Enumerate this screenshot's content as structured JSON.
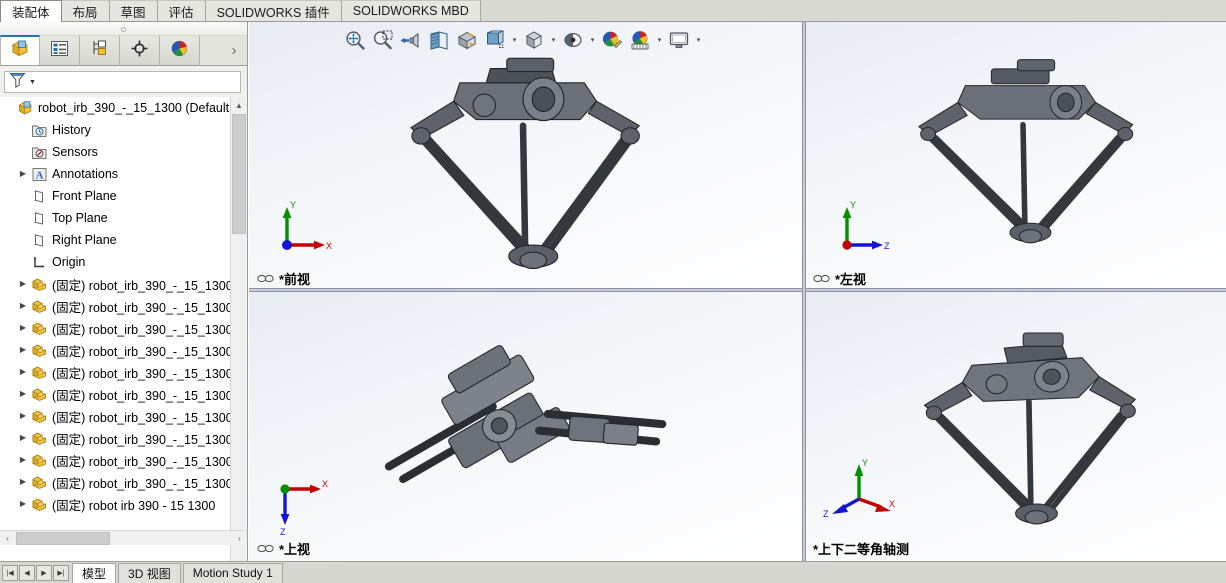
{
  "app": {
    "title": "SOLIDWORKS Assembly"
  },
  "command_manager": {
    "tabs": [
      {
        "label": "装配体",
        "active": true
      },
      {
        "label": "布局",
        "active": false
      },
      {
        "label": "草图",
        "active": false
      },
      {
        "label": "评估",
        "active": false
      },
      {
        "label": "SOLIDWORKS 插件",
        "active": false
      },
      {
        "label": "SOLIDWORKS MBD",
        "active": false
      }
    ]
  },
  "feature_manager": {
    "tabs": [
      {
        "name": "feature-tree-tab",
        "icon": "assembly-tree-icon",
        "active": true
      },
      {
        "name": "property-manager-tab",
        "icon": "property-list-icon",
        "active": false
      },
      {
        "name": "configuration-manager-tab",
        "icon": "configuration-icon",
        "active": false
      },
      {
        "name": "dimxpert-manager-tab",
        "icon": "dimxpert-target-icon",
        "active": false
      },
      {
        "name": "display-manager-tab",
        "icon": "display-sphere-icon",
        "active": false
      }
    ],
    "expand_chevron": "›",
    "filter": {
      "icon": "filter-funnel-icon",
      "value": "",
      "placeholder": ""
    },
    "tree": [
      {
        "label": "robot_irb_390_-_15_1300  (Default",
        "icon": "assembly-icon",
        "depth": 0,
        "expandable": false,
        "chevron": ""
      },
      {
        "label": "History",
        "icon": "history-folder-icon",
        "depth": 1,
        "expandable": false,
        "chevron": ""
      },
      {
        "label": "Sensors",
        "icon": "sensors-folder-icon",
        "depth": 1,
        "expandable": false,
        "chevron": ""
      },
      {
        "label": "Annotations",
        "icon": "annotations-icon",
        "depth": 1,
        "expandable": true,
        "chevron": "▶"
      },
      {
        "label": "Front Plane",
        "icon": "plane-icon",
        "depth": 1,
        "expandable": false,
        "chevron": ""
      },
      {
        "label": "Top Plane",
        "icon": "plane-icon",
        "depth": 1,
        "expandable": false,
        "chevron": ""
      },
      {
        "label": "Right Plane",
        "icon": "plane-icon",
        "depth": 1,
        "expandable": false,
        "chevron": ""
      },
      {
        "label": "Origin",
        "icon": "origin-icon",
        "depth": 1,
        "expandable": false,
        "chevron": ""
      },
      {
        "label": "(固定) robot_irb_390_-_15_1300",
        "icon": "part-icon",
        "depth": 1,
        "expandable": true,
        "chevron": "▶"
      },
      {
        "label": "(固定) robot_irb_390_-_15_1300",
        "icon": "part-icon",
        "depth": 1,
        "expandable": true,
        "chevron": "▶"
      },
      {
        "label": "(固定) robot_irb_390_-_15_1300",
        "icon": "part-icon",
        "depth": 1,
        "expandable": true,
        "chevron": "▶"
      },
      {
        "label": "(固定) robot_irb_390_-_15_1300",
        "icon": "part-icon",
        "depth": 1,
        "expandable": true,
        "chevron": "▶"
      },
      {
        "label": "(固定) robot_irb_390_-_15_1300",
        "icon": "part-icon",
        "depth": 1,
        "expandable": true,
        "chevron": "▶"
      },
      {
        "label": "(固定) robot_irb_390_-_15_1300",
        "icon": "part-icon",
        "depth": 1,
        "expandable": true,
        "chevron": "▶"
      },
      {
        "label": "(固定) robot_irb_390_-_15_1300",
        "icon": "part-icon",
        "depth": 1,
        "expandable": true,
        "chevron": "▶"
      },
      {
        "label": "(固定) robot_irb_390_-_15_1300",
        "icon": "part-icon",
        "depth": 1,
        "expandable": true,
        "chevron": "▶"
      },
      {
        "label": "(固定) robot_irb_390_-_15_1300",
        "icon": "part-icon",
        "depth": 1,
        "expandable": true,
        "chevron": "▶"
      },
      {
        "label": "(固定) robot_irb_390_-_15_1300",
        "icon": "part-icon",
        "depth": 1,
        "expandable": true,
        "chevron": "▶"
      },
      {
        "label": "(固定) robot irb 390 - 15 1300",
        "icon": "part-icon",
        "depth": 1,
        "expandable": true,
        "chevron": "▶"
      }
    ],
    "scrollbar": {
      "up_arrow": "▲",
      "down_arrow": "▼",
      "left_arrow": "‹",
      "right_arrow": "›"
    }
  },
  "view_toolbar": {
    "buttons": [
      {
        "name": "zoom-to-fit-button",
        "icon": "zoom-to-fit-icon",
        "caret": false
      },
      {
        "name": "zoom-to-area-button",
        "icon": "zoom-to-area-icon",
        "caret": false
      },
      {
        "name": "previous-view-button",
        "icon": "previous-view-icon",
        "caret": false
      },
      {
        "name": "section-view-button",
        "icon": "section-view-icon",
        "caret": false
      },
      {
        "name": "view-orientation-button",
        "icon": "view-orientation-icon",
        "caret": false
      },
      {
        "name": "display-style-button",
        "icon": "display-style-icon",
        "caret": true
      },
      {
        "name": "hide-show-items-button",
        "icon": "hide-show-cube-icon",
        "caret": true
      },
      {
        "name": "edit-appearance-button",
        "icon": "eye-display-icon",
        "caret": true
      },
      {
        "name": "apply-scene-button",
        "icon": "appearance-palette-icon",
        "caret": false
      },
      {
        "name": "view-settings-button",
        "icon": "scene-palette-icon",
        "caret": true
      },
      {
        "name": "viewport-layout-button",
        "icon": "monitor-viewport-icon",
        "caret": true
      }
    ]
  },
  "viewports": [
    {
      "name": "viewport-front",
      "label": "*前视",
      "linked_icon": "link-views-icon",
      "triad": {
        "up_axis": "Y",
        "right_axis": "X",
        "origin_axis": "Z",
        "style": "front"
      }
    },
    {
      "name": "viewport-left",
      "label": "*左视",
      "linked_icon": "link-views-icon",
      "triad": {
        "up_axis": "Y",
        "right_axis": "Z",
        "origin_axis": "X",
        "style": "left"
      }
    },
    {
      "name": "viewport-top",
      "label": "*上视",
      "linked_icon": "link-views-icon",
      "triad": {
        "up_axis": "X",
        "right_axis": "X",
        "origin_axis": "Y",
        "style": "top",
        "down_axis": "Z"
      }
    },
    {
      "name": "viewport-dimetric",
      "label": "*上下二等角轴测",
      "linked_icon": "",
      "triad": {
        "up_axis": "Y",
        "right_axis": "X",
        "origin_axis": "Z",
        "style": "iso"
      }
    }
  ],
  "bottom_bar": {
    "nav_buttons": [
      "|◀",
      "◀",
      "▶",
      "▶|"
    ],
    "tabs": [
      {
        "label": "模型",
        "active": true
      },
      {
        "label": "3D 视图",
        "active": false
      },
      {
        "label": "Motion Study 1",
        "active": false
      }
    ]
  },
  "colors": {
    "axis_x": "#c40000",
    "axis_y": "#009000",
    "axis_z": "#1414d0",
    "accent": "#2b6fb5",
    "panel_bg": "#f0f0ec",
    "viewport_bg": "#eef1f6",
    "model_dark": "#3b3f45"
  }
}
